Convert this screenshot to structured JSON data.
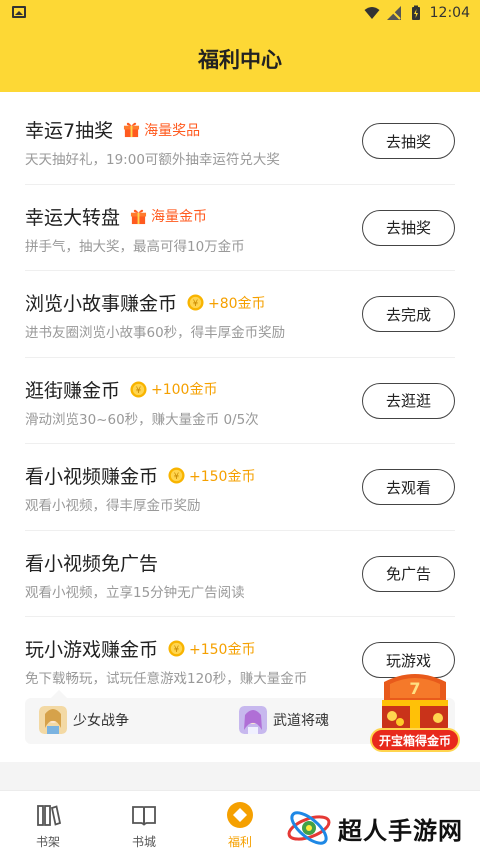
{
  "status_bar": {
    "time": "12:04"
  },
  "header": {
    "title": "福利中心"
  },
  "tasks": [
    {
      "title": "幸运7抽奖",
      "badge": "海量奖品",
      "badge_type": "gift",
      "desc": "天天抽好礼，19:00可额外抽幸运符兑大奖",
      "button": "去抽奖"
    },
    {
      "title": "幸运大转盘",
      "badge": "海量金币",
      "badge_type": "gift",
      "desc": "拼手气，抽大奖，最高可得10万金币",
      "button": "去抽奖"
    },
    {
      "title": "浏览小故事赚金币",
      "badge": "+80金币",
      "badge_type": "coin",
      "desc": "进书友圈浏览小故事60秒，得丰厚金币奖励",
      "button": "去完成"
    },
    {
      "title": "逛街赚金币",
      "badge": "+100金币",
      "badge_type": "coin",
      "desc": "滑动浏览30~60秒，赚大量金币 0/5次",
      "button": "去逛逛"
    },
    {
      "title": "看小视频赚金币",
      "badge": "+150金币",
      "badge_type": "coin",
      "desc": "观看小视频，得丰厚金币奖励",
      "button": "去观看"
    },
    {
      "title": "看小视频免广告",
      "badge": "",
      "badge_type": "none",
      "desc": "观看小视频，立享15分钟无广告阅读",
      "button": "免广告"
    },
    {
      "title": "玩小游戏赚金币",
      "badge": "+150金币",
      "badge_type": "coin",
      "desc": "免下载畅玩，试玩任意游戏120秒，赚大量金币",
      "button": "玩游戏"
    }
  ],
  "games": [
    {
      "name": "少女战争"
    },
    {
      "name": "武道将魂"
    }
  ],
  "treasure": {
    "label": "开宝箱得金币"
  },
  "bottom_nav": [
    {
      "label": "书架",
      "icon": "bookshelf-icon",
      "active": false
    },
    {
      "label": "书城",
      "icon": "book-icon",
      "active": false
    },
    {
      "label": "福利",
      "icon": "welfare-icon",
      "active": true
    }
  ],
  "watermark": {
    "text": "超人手游网"
  },
  "colors": {
    "accent": "#fdd835",
    "coin": "#f5a000",
    "gift": "#ff5a1f",
    "treasure_red": "#e8291c"
  }
}
